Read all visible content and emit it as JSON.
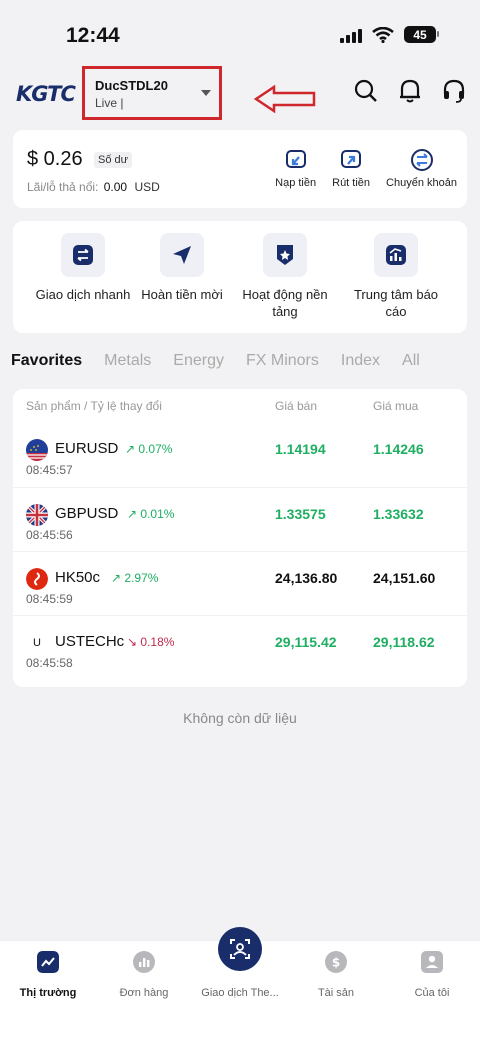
{
  "status": {
    "time": "12:44",
    "battery": "45"
  },
  "header": {
    "logo": "KGTC",
    "account_name": "DucSTDL20",
    "account_type": "Live |"
  },
  "balance": {
    "amount": "$ 0.26",
    "tag": "Số dư",
    "pnl_label": "Lãi/lỗ thả nổi:",
    "pnl_value": "0.00",
    "pnl_currency": "USD",
    "actions": [
      "Nạp tiền",
      "Rút tiền",
      "Chuyển khoản"
    ]
  },
  "quick_actions": [
    {
      "label": "Giao dịch nhanh",
      "icon": "swap-icon"
    },
    {
      "label": "Hoàn tiền mời",
      "icon": "send-icon"
    },
    {
      "label": "Hoạt động nền tảng",
      "icon": "badge-icon"
    },
    {
      "label": "Trung tâm báo cáo",
      "icon": "report-icon"
    }
  ],
  "tabs": [
    "Favorites",
    "Metals",
    "Energy",
    "FX Minors",
    "Index",
    "All"
  ],
  "list": {
    "headers": {
      "product": "Sản phẩm / Tỷ lệ thay đổi",
      "bid": "Giá bán",
      "ask": "Giá mua"
    },
    "rows": [
      {
        "symbol": "EURUSD",
        "change": "↗ 0.07%",
        "dir": "up",
        "time": "08:45:57",
        "bid": "1.14194",
        "ask": "1.14246",
        "price_dir": "up"
      },
      {
        "symbol": "GBPUSD",
        "change": "↗ 0.01%",
        "dir": "up",
        "time": "08:45:56",
        "bid": "1.33575",
        "ask": "1.33632",
        "price_dir": "up"
      },
      {
        "symbol": "HK50c",
        "change": "↗ 2.97%",
        "dir": "up",
        "time": "08:45:59",
        "bid": "24,136.80",
        "ask": "24,151.60",
        "price_dir": "flat"
      },
      {
        "symbol": "USTECHc",
        "change": "↘ 0.18%",
        "dir": "down",
        "time": "08:45:58",
        "bid": "29,115.42",
        "ask": "29,118.62",
        "price_dir": "up"
      }
    ],
    "row_icon_letter": "U"
  },
  "no_more": "Không còn dữ liệu",
  "nav": [
    "Thị trường",
    "Đơn hàng",
    "Giao dịch The...",
    "Tài sản",
    "Của tôi"
  ],
  "colors": {
    "brand": "#1a2d6b",
    "up": "#1fae62",
    "down": "#c12a4a",
    "annotation": "#d0272d"
  }
}
